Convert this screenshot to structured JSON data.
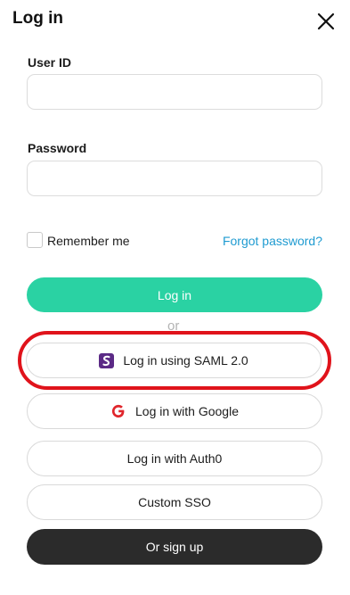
{
  "header": {
    "title": "Log in"
  },
  "form": {
    "user_id_label": "User ID",
    "user_id_value": "",
    "password_label": "Password",
    "password_value": "",
    "remember_label": "Remember me",
    "remember_checked": false,
    "forgot_link": "Forgot password?"
  },
  "actions": {
    "login_label": "Log in",
    "or_label": "or",
    "saml_label": "Log in using SAML 2.0",
    "google_label": "Log in with Google",
    "auth0_label": "Log in with Auth0",
    "custom_sso_label": "Custom SSO",
    "signup_label": "Or sign up"
  },
  "icons": {
    "close": "close-icon",
    "saml": "saml-icon",
    "google": "google-icon"
  },
  "colors": {
    "primary": "#2ad2a3",
    "link": "#1f9bd1",
    "dark_button": "#2b2b2b",
    "highlight": "#e0131b",
    "saml_icon": "#5b2a86",
    "google_icon": "#e0262c"
  }
}
